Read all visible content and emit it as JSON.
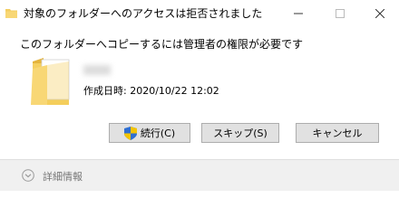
{
  "window": {
    "title": "対象のフォルダーへのアクセスは拒否されました",
    "icons": {
      "app": "folder-icon",
      "minimize": "minimize-icon",
      "maximize": "maximize-icon",
      "close": "close-icon"
    }
  },
  "dialog": {
    "message": "このフォルダーへコピーするには管理者の権限が必要です",
    "item": {
      "icon": "folder-icon",
      "date_line": "作成日時: 2020/10/22 12:02"
    }
  },
  "buttons": {
    "continue_label": "続行(C)",
    "continue_icon": "uac-shield-icon",
    "skip_label": "スキップ(S)",
    "cancel_label": "キャンセル"
  },
  "footer": {
    "details_label": "詳細情報",
    "details_icon": "chevron-down-circle-icon"
  },
  "colors": {
    "folder": "#f3cd60",
    "shield_blue": "#2f6fd2",
    "shield_yellow": "#f5c400",
    "button_bg": "#e1e1e1",
    "footer_bg": "#f0f0f0"
  }
}
